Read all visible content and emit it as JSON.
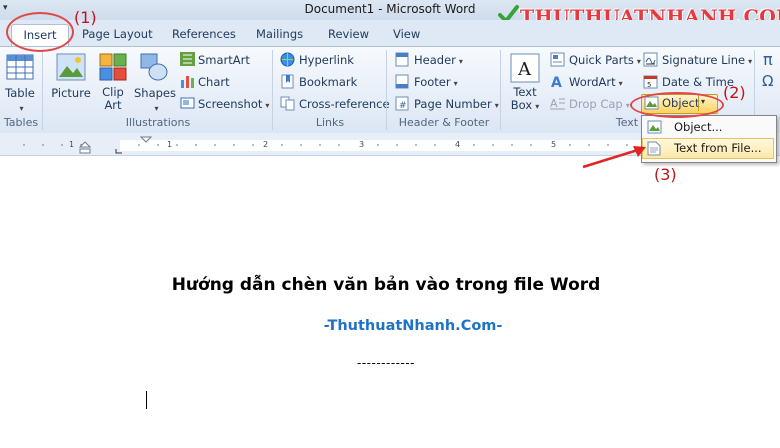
{
  "window": {
    "title": "Document1 - Microsoft Word"
  },
  "watermark": {
    "text": "THUTHUATNHANH.COM",
    "color": "#e8373d"
  },
  "tabs": [
    {
      "label": "Page Layout"
    },
    {
      "label": "References"
    },
    {
      "label": "Mailings"
    },
    {
      "label": "Review"
    },
    {
      "label": "View"
    }
  ],
  "active_tab": {
    "label": "Insert"
  },
  "ribbon": {
    "tables": {
      "button": "Table",
      "group": "Tables"
    },
    "illustrations": {
      "picture": "Picture",
      "clip_art": "Clip\nArt",
      "shapes": "Shapes",
      "smartart": "SmartArt",
      "chart": "Chart",
      "screenshot": "Screenshot",
      "group": "Illustrations"
    },
    "links": {
      "hyperlink": "Hyperlink",
      "bookmark": "Bookmark",
      "cross_reference": "Cross-reference",
      "group": "Links"
    },
    "header_footer": {
      "header": "Header",
      "footer": "Footer",
      "page_number": "Page Number",
      "group": "Header & Footer"
    },
    "text": {
      "text_box": "Text\nBox",
      "quick_parts": "Quick Parts",
      "wordart": "WordArt",
      "drop_cap": "Drop Cap",
      "signature_line": "Signature Line",
      "date_time": "Date & Time",
      "object": "Object",
      "group": "Text"
    },
    "symbols": {
      "pi": "π",
      "omega": "Ω"
    }
  },
  "object_menu": {
    "items": [
      {
        "label": "Object..."
      },
      {
        "label": "Text from File..."
      }
    ]
  },
  "annotations": {
    "step1": "(1)",
    "step2": "(2)",
    "step3": "(3)",
    "color": "#c0141a"
  },
  "document": {
    "heading": "Hướng dẫn chèn văn bản vào trong file Word",
    "subheading": "-ThuthuatNhanh.Com-",
    "divider": "------------"
  }
}
